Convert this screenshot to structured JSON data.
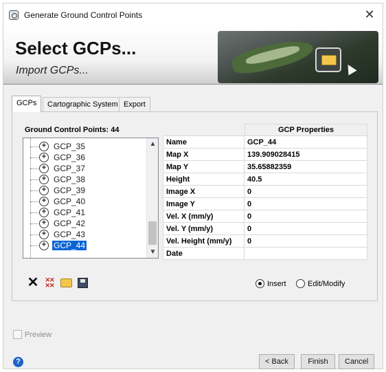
{
  "window": {
    "title": "Generate Ground Control Points",
    "close_glyph": "✕"
  },
  "banner": {
    "heading": "Select GCPs...",
    "subheading": "Import GCPs..."
  },
  "tabs": [
    {
      "label": "GCPs",
      "active": true
    },
    {
      "label": "Cartographic System",
      "active": false
    },
    {
      "label": "Export",
      "active": false
    }
  ],
  "gcp_list": {
    "count_label": "Ground Control Points: 44",
    "items": [
      "GCP_35",
      "GCP_36",
      "GCP_37",
      "GCP_38",
      "GCP_39",
      "GCP_40",
      "GCP_41",
      "GCP_42",
      "GCP_43",
      "GCP_44"
    ],
    "selected": "GCP_44",
    "item_icon": "target-plus-icon"
  },
  "properties": {
    "header": "GCP Properties",
    "rows": [
      {
        "key": "Name",
        "value": "GCP_44"
      },
      {
        "key": "Map X",
        "value": "139.909028415"
      },
      {
        "key": "Map Y",
        "value": "35.65882359"
      },
      {
        "key": "Height",
        "value": "40.5"
      },
      {
        "key": "Image X",
        "value": "0"
      },
      {
        "key": "Image Y",
        "value": "0"
      },
      {
        "key": "Vel. X (mm/y)",
        "value": "0"
      },
      {
        "key": "Vel. Y (mm/y)",
        "value": "0"
      },
      {
        "key": "Vel. Height (mm/y)",
        "value": "0"
      },
      {
        "key": "Date",
        "value": ""
      }
    ]
  },
  "toolbar": {
    "delete_icon": "delete-x-icon",
    "delete_all_icon": "delete-all-icon",
    "open_icon": "open-folder-icon",
    "save_icon": "save-disk-icon"
  },
  "mode": {
    "insert_label": "Insert",
    "edit_label": "Edit/Modify",
    "selected": "Insert"
  },
  "preview": {
    "label": "Preview",
    "checked": false
  },
  "buttons": {
    "back": "< Back",
    "finish": "Finish",
    "cancel": "Cancel"
  },
  "help": {
    "glyph": "?"
  }
}
